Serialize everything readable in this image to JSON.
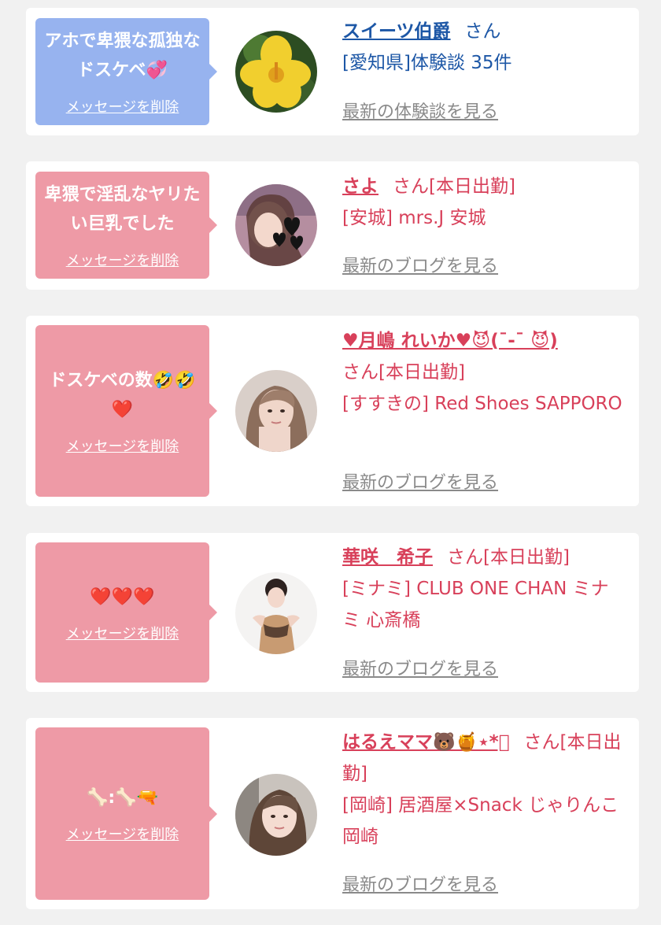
{
  "colors": {
    "blue_bubble": "#97b3ef",
    "pink_bubble": "#ee9aa6",
    "blue_text": "#1d57a6",
    "pink_text": "#d8405a",
    "link_gray": "#8a8a8a"
  },
  "cards": [
    {
      "message": "アホで卑猥な孤独なドスケベ💞",
      "delete_label": "メッセージを削除",
      "name": "スイーツ伯爵",
      "suffix": "さん",
      "shop": "[愛知県]体験談 35件",
      "link": "最新の体験談を見る"
    },
    {
      "message": "卑猥で淫乱なヤリたい巨乳でした",
      "delete_label": "メッセージを削除",
      "name": "さよ",
      "suffix": "さん[本日出勤]",
      "shop": "[安城] mrs.J 安城",
      "link": "最新のブログを見る"
    },
    {
      "message": "ドスケベの数🤣🤣❤️",
      "delete_label": "メッセージを削除",
      "name": "♥月嶋 れいか♥😈(¯-¯ 😈)",
      "suffix": "さん[本日出勤]",
      "shop": "[すすきの] Red Shoes SAPPORO",
      "link": "最新のブログを見る"
    },
    {
      "message": "❤️❤️❤️",
      "delete_label": "メッセージを削除",
      "name": "華咲　希子",
      "suffix": "さん[本日出勤]",
      "shop": "[ミナミ] CLUB ONE CHAN ミナミ 心斎橋",
      "link": "最新のブログを見る"
    },
    {
      "message": "🦴:🦴🔫",
      "delete_label": "メッセージを削除",
      "name": "はるえママ🐻🍯⋆*ﾟ",
      "suffix": "さん[本日出勤]",
      "shop": "[岡崎] 居酒屋×Snack じゃりんこ岡崎",
      "link": "最新のブログを見る"
    }
  ],
  "avatars": [
    "yellow-flower-photo",
    "woman-with-hearts-photo",
    "woman-portrait-photo",
    "woman-in-dress-photo",
    "woman-selfie-photo"
  ]
}
